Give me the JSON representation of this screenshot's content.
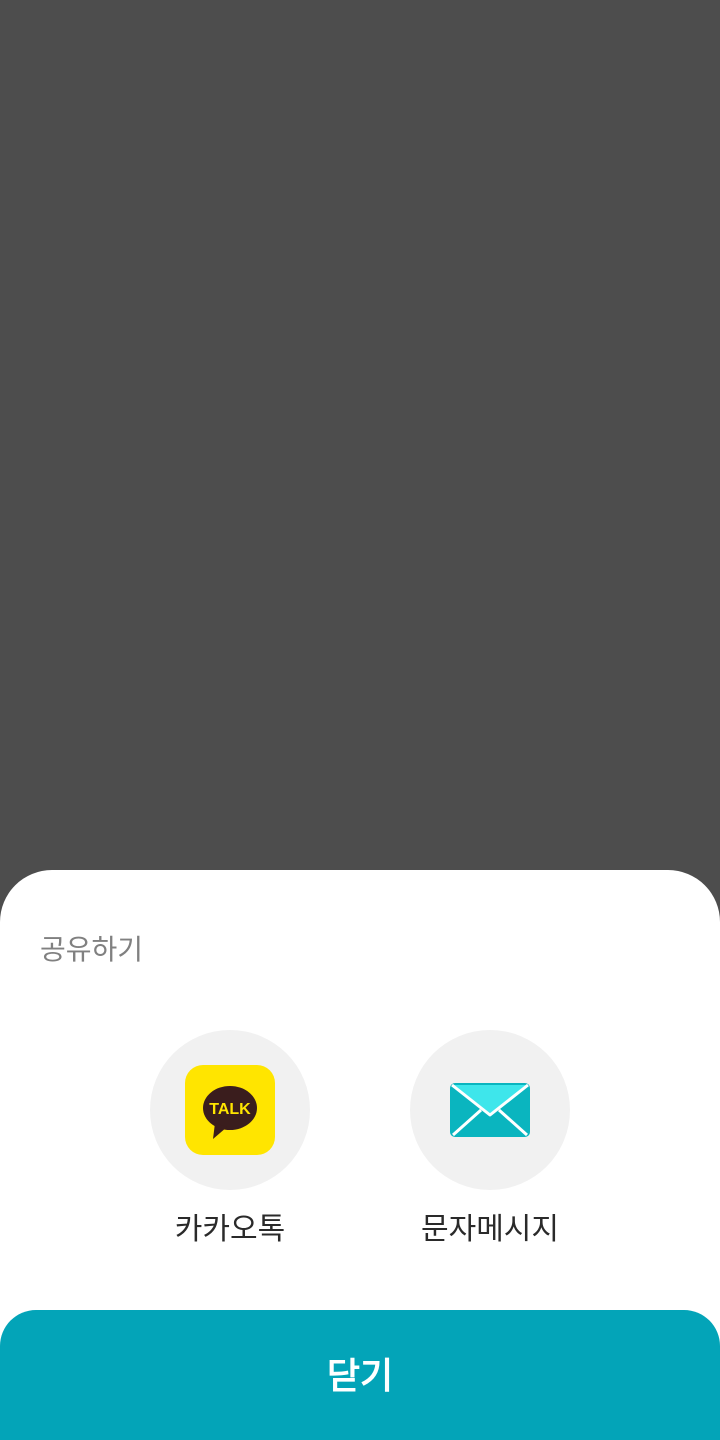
{
  "share_sheet": {
    "title": "공유하기",
    "options": [
      {
        "label": "카카오톡",
        "icon": "kakaotalk-icon",
        "icon_text": "TALK",
        "icon_bg": "#FFE500",
        "icon_fg": "#3A1D1D"
      },
      {
        "label": "문자메시지",
        "icon": "envelope-icon",
        "icon_color": "#0AB5BF",
        "icon_flap": "#3EE6EB"
      }
    ],
    "close_label": "닫기"
  },
  "colors": {
    "backdrop": "#4D4D4D",
    "sheet": "#FFFFFF",
    "option_circle": "#F1F1F1",
    "accent": "#03A4B8"
  }
}
